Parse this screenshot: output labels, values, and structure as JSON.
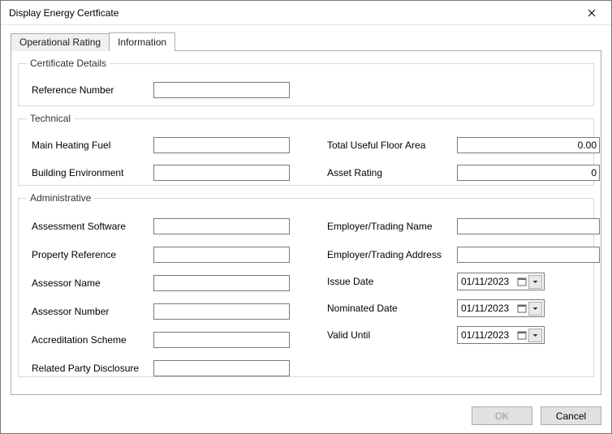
{
  "window": {
    "title": "Display Energy Certficate"
  },
  "tabs": {
    "operational": "Operational Rating",
    "information": "Information"
  },
  "groups": {
    "certificate": "Certificate Details",
    "technical": "Technical",
    "administrative": "Administrative"
  },
  "labels": {
    "reference_number": "Reference Number",
    "main_heating_fuel": "Main Heating Fuel",
    "building_environment": "Building Environment",
    "total_useful_floor_area": "Total Useful Floor Area",
    "asset_rating": "Asset Rating",
    "assessment_software": "Assessment Software",
    "property_reference": "Property Reference",
    "assessor_name": "Assessor Name",
    "assessor_number": "Assessor Number",
    "accreditation_scheme": "Accreditation Scheme",
    "related_party_disclosure": "Related Party Disclosure",
    "employer_trading_name": "Employer/Trading Name",
    "employer_trading_address": "Employer/Trading Address",
    "issue_date": "Issue Date",
    "nominated_date": "Nominated Date",
    "valid_until": "Valid Until"
  },
  "values": {
    "reference_number": "",
    "main_heating_fuel": "",
    "building_environment": "",
    "total_useful_floor_area": "0.00",
    "asset_rating": "0",
    "assessment_software": "",
    "property_reference": "",
    "assessor_name": "",
    "assessor_number": "",
    "accreditation_scheme": "",
    "related_party_disclosure": "",
    "employer_trading_name": "",
    "employer_trading_address": "",
    "issue_date": "01/11/2023",
    "nominated_date": "01/11/2023",
    "valid_until": "01/11/2023"
  },
  "buttons": {
    "ok": "OK",
    "cancel": "Cancel"
  }
}
